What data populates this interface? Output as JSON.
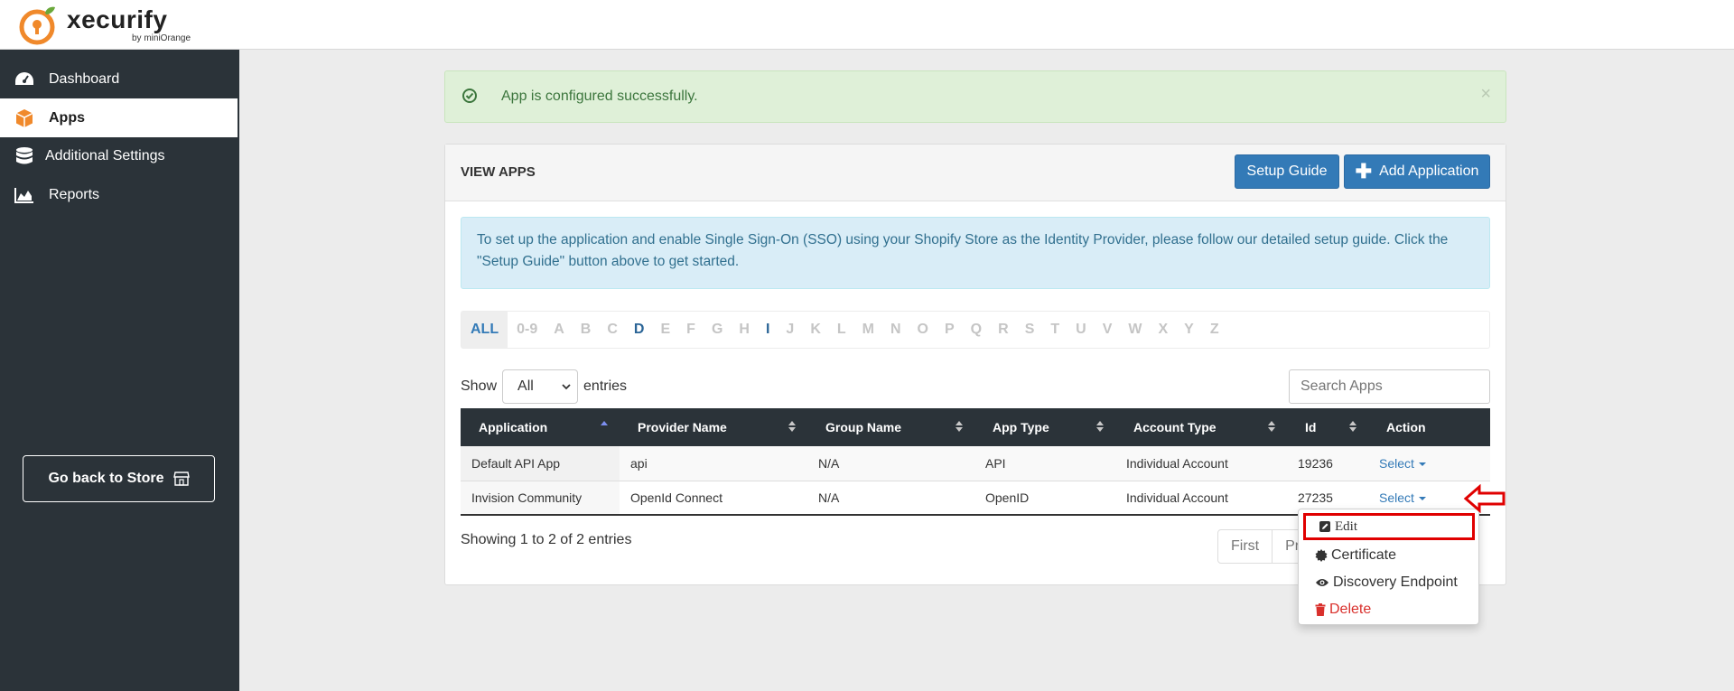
{
  "brand": {
    "name": "xecurify",
    "sub": "by miniOrange",
    "accent": "#f0892b"
  },
  "sidebar": {
    "items": [
      {
        "label": "Dashboard",
        "icon": "dashboard-icon"
      },
      {
        "label": "Apps",
        "icon": "box-icon",
        "active": true
      },
      {
        "label": "Additional Settings",
        "icon": "database-icon"
      },
      {
        "label": "Reports",
        "icon": "area-chart-icon"
      }
    ],
    "back_label": "Go back to Store"
  },
  "alert": {
    "message": "App is configured successfully.",
    "close": "×"
  },
  "panel": {
    "title": "VIEW APPS",
    "setup_guide": "Setup Guide",
    "add_application": "Add Application",
    "info": "To set up the application and enable Single Sign-On (SSO) using your Shopify Store as the Identity Provider, please follow our detailed setup guide. Click the \"Setup Guide\" button above to get started."
  },
  "alpha_filter": [
    "ALL",
    "0-9",
    "A",
    "B",
    "C",
    "D",
    "E",
    "F",
    "G",
    "H",
    "I",
    "J",
    "K",
    "L",
    "M",
    "N",
    "O",
    "P",
    "Q",
    "R",
    "S",
    "T",
    "U",
    "V",
    "W",
    "X",
    "Y",
    "Z"
  ],
  "length": {
    "show": "Show",
    "value": "All",
    "entries": "entries"
  },
  "search": {
    "placeholder": "Search Apps"
  },
  "table": {
    "headers": [
      "Application",
      "Provider Name",
      "Group Name",
      "App Type",
      "Account Type",
      "Id",
      "Action"
    ],
    "rows": [
      [
        "Default API App",
        "api",
        "N/A",
        "API",
        "Individual Account",
        "19236",
        "Select"
      ],
      [
        "Invision Community",
        "OpenId Connect",
        "N/A",
        "OpenID",
        "Individual Account",
        "27235",
        "Select"
      ]
    ]
  },
  "footer": {
    "info": "Showing 1 to 2 of 2 entries",
    "first": "First",
    "previous": "Pr"
  },
  "dropdown": {
    "edit": "Edit",
    "certificate": "Certificate",
    "discovery": "Discovery Endpoint",
    "delete": "Delete"
  }
}
